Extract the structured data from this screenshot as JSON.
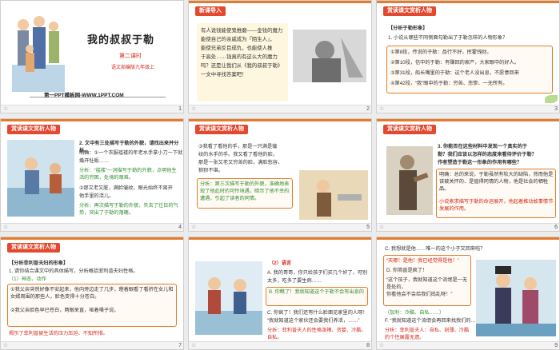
{
  "slides": [
    {
      "num": "1",
      "title": "我的叔叔于勒",
      "subtitle": "第二课时",
      "publisher": "语文部编版九年级上",
      "site": "第一PPT模板网-WWW.1PPT.COM"
    },
    {
      "num": "2",
      "badge": "新课导入",
      "lines": [
        "有人说钱能使鬼推磨——金钱的魔力",
        "能使自己的亲戚成为「陌生人」，",
        "能使兄弟反目成仇，也能使人推",
        "于高处……钱真的有这么大的魔力",
        "吗？还是让我们从《我的叔叔于勒》",
        "一文中寻找答案吧！"
      ]
    },
    {
      "num": "3",
      "badge": "赏读课文赏析人物",
      "heading": "【分析于勒形象】",
      "question": "1. 小说从哪些不同侧面勾勒出了于勒怎样的人物形象？",
      "items": [
        "①第8段，传说的于勒：品行不好，挥霍钱财。",
        "②第10段，信中的于勒：有赚回的家产，大家眼中的好人。",
        "③第31段，船长嘴里的于勒：这个老人没出息，不愿意回来",
        "④第42段，“我”眼中的于勒：穷苦、悲惨、一无所有。"
      ]
    },
    {
      "num": "4",
      "badge": "赏读课文赏析人物",
      "lines": [
        "2. 文中有三处描写于勒的外貌，请找出来并分析。",
        "明确：①一个衣服褴褛的年老水手拿小刀一下就",
        "撬开牡蛎……",
        "分析：“褴褛”一词描写于勒的外貌，点明他生活的穷困，处境的艰难。",
        "②那又老又脏，满脸皱纹，眼光始终不离开",
        "他手里的活儿。",
        "分析：再次描写于勒的外貌，失去了往日的气势，突出了于勒的落魄。"
      ]
    },
    {
      "num": "5",
      "badge": "赏读课文赏析人物",
      "lines": [
        "③我看了看他的手，那是一只满是皱",
        "纹的水手的手。我又看了看他的脸，",
        "那是一张又老又穷苦的脸，满脸愁容，",
        "狼狈不堪。"
      ],
      "analysis": "分析：第三次描写于勒的外貌，准确地表现了他此时的可怜境遇，暗示了他不幸的遭遇，引起了读者的同情。"
    },
    {
      "num": "6",
      "badge": "赏读课文赏析人物",
      "lines": [
        "3. 你能否在这些材料中发现一个真实的于",
        "勒？我们应该以怎样的态度来看待评价于勒？",
        "作者塑造于勒这一形象的作用有哪些？"
      ],
      "answer": "明确：总的来说，于勒虽然有较大的缺陷，然而他是该被关怀的、是值得同情的人物，他是社会的牺牲品。",
      "answer2": "小说索求描写于勒的命运展开，他起着推动故事情节发展的作用。"
    },
    {
      "num": "7",
      "badge": "赏读课文赏析人物",
      "heading": "【分析菲利普夫妇的形象】",
      "question": "1. 请你结合课文中的具体描写，分析概括菲利普夫妇性格。",
      "sub1": "（1）神态、动作",
      "body": "①我父亲突然好像不安起来，他向旁边走了几步，瞪着眼看了看挤在女儿和女婿周围的那些人，脸色变得十分苍白。",
      "body2": "②我父亲脸色早已苍白，两眼呆直，哑着嗓子说。",
      "conclusion": "揭示了菲利普被生活的压力压迫、不知所措。"
    },
    {
      "num": "8",
      "badge": "（2）语言",
      "lines": [
        "A. 我的哥哥，你只给孩子们买几个好了，可别",
        "太多，吃多了要生病……",
        "B. 你瞧了！我就知道这个于勒不会有出息的",
        "C. 你疯了！我们还有什么脸面见家里的人呀！",
        "“我就知道这个家伙还会要我们养活，……”",
        "分析：菲利普夫人的性格泼辣、贪婪、冷酷、自私。"
      ]
    },
    {
      "num": "9",
      "lines": [
        "C. 我想就是他……唯一的这个小子又回来啦？",
        "“天哪！是他！我已经觉得是他！”",
        "D. 你简直是疯了！",
        "“这个孩子，我就知道这个流氓是一无是处的，",
        "你看他会不会给我们捣乱呀！”",
        "（加利：冷酷、自私……）",
        "F. “我就知道这个流氓会再回来找我们的……”"
      ],
      "analysis": "分析：菲利普夫人：自私、刻薄、冷酷的个性展露无遗。"
    }
  ]
}
